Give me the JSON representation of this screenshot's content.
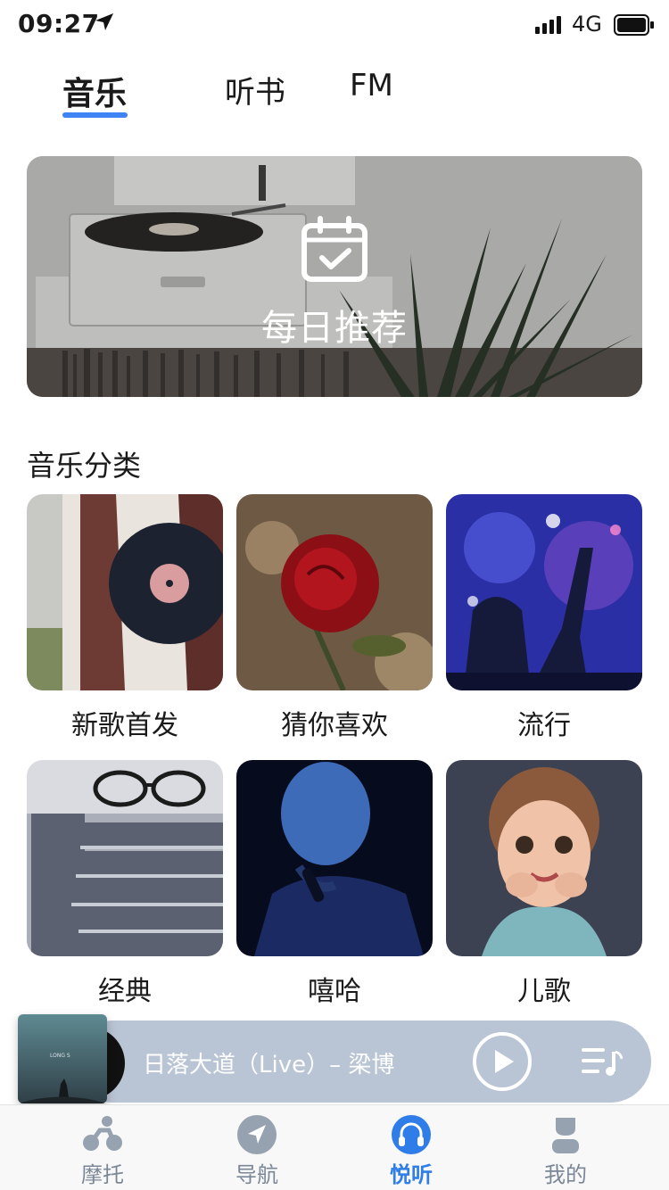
{
  "status": {
    "time": "09:27",
    "network": "4G",
    "icons": [
      "location-arrow-icon",
      "signal-icon",
      "battery-icon"
    ]
  },
  "tabs": [
    {
      "label": "音乐",
      "active": true
    },
    {
      "label": "听书",
      "active": false
    },
    {
      "label": "FM",
      "active": false
    }
  ],
  "banner": {
    "title": "每日推荐",
    "icon": "calendar-check-icon"
  },
  "section": {
    "title": "音乐分类"
  },
  "categories": [
    {
      "label": "新歌首发"
    },
    {
      "label": "猜你喜欢"
    },
    {
      "label": "流行"
    },
    {
      "label": "经典"
    },
    {
      "label": "嘻哈"
    },
    {
      "label": "儿歌"
    }
  ],
  "player": {
    "song": "日落大道（Live）– 梁博",
    "cover_text": "LONG S",
    "icons": [
      "play-icon",
      "playlist-icon"
    ]
  },
  "nav": [
    {
      "label": "摩托",
      "icon": "motorbike-icon",
      "active": false
    },
    {
      "label": "导航",
      "icon": "navigation-icon",
      "active": false
    },
    {
      "label": "悦听",
      "icon": "headphones-icon",
      "active": true
    },
    {
      "label": "我的",
      "icon": "person-icon",
      "active": false
    }
  ],
  "colors": {
    "accent": "#3e84f5",
    "nav_active": "#2f7de9",
    "nav_inactive": "#7b8796",
    "player_bar": "#b9c4d4"
  }
}
